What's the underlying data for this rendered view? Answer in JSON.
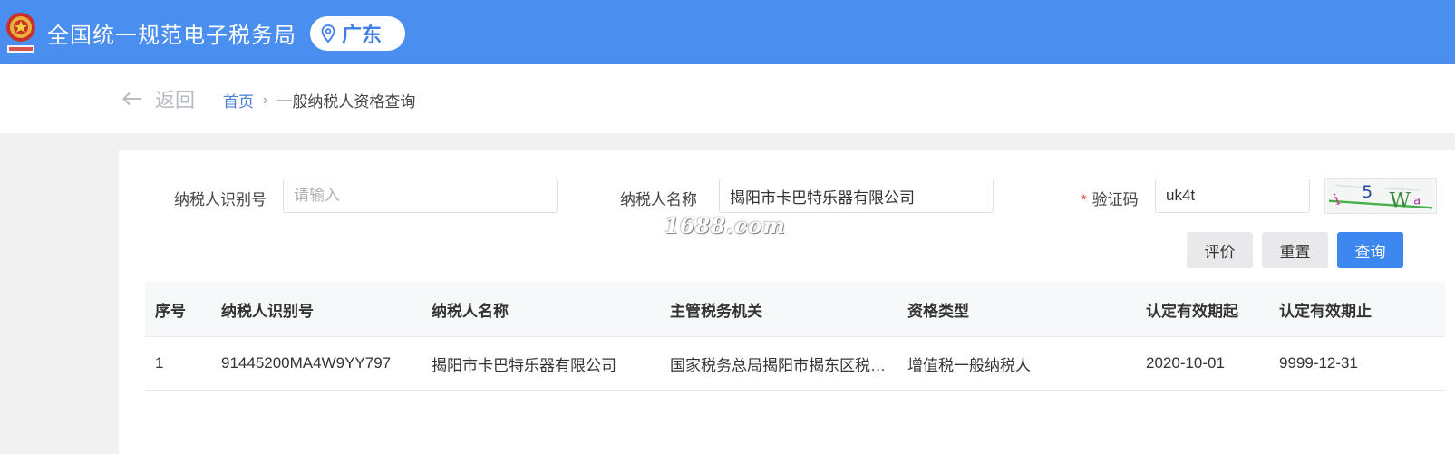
{
  "header": {
    "title": "全国统一规范电子税务局",
    "region": "广东",
    "emblem_icon": "national-tax-emblem",
    "region_icon": "location-pin-icon"
  },
  "nav": {
    "back_label": "返回",
    "breadcrumb": {
      "home": "首页",
      "separator": "›",
      "current": "一般纳税人资格查询"
    }
  },
  "form": {
    "taxpayer_id": {
      "label": "纳税人识别号",
      "value": "",
      "placeholder": "请输入"
    },
    "taxpayer_name": {
      "label": "纳税人名称",
      "value": "揭阳市卡巴特乐器有限公司",
      "placeholder": ""
    },
    "captcha": {
      "required_mark": "*",
      "label": "验证码",
      "value": "uk4t",
      "image_text": "i 5 W"
    },
    "buttons": {
      "evaluate": "评价",
      "reset": "重置",
      "search": "查询"
    }
  },
  "watermark": "1688.com",
  "table": {
    "headers": [
      "序号",
      "纳税人识别号",
      "纳税人名称",
      "主管税务机关",
      "资格类型",
      "认定有效期起",
      "认定有效期止"
    ],
    "rows": [
      [
        "1",
        "91445200MA4W9YY797",
        "揭阳市卡巴特乐器有限公司",
        "国家税务总局揭阳市揭东区税…",
        "增值税一般纳税人",
        "2020-10-01",
        "9999-12-31"
      ]
    ]
  },
  "colors": {
    "header_bg": "#4a8ef0",
    "primary": "#3c87f0",
    "link": "#4a7fd9",
    "required": "#e24b3b"
  }
}
